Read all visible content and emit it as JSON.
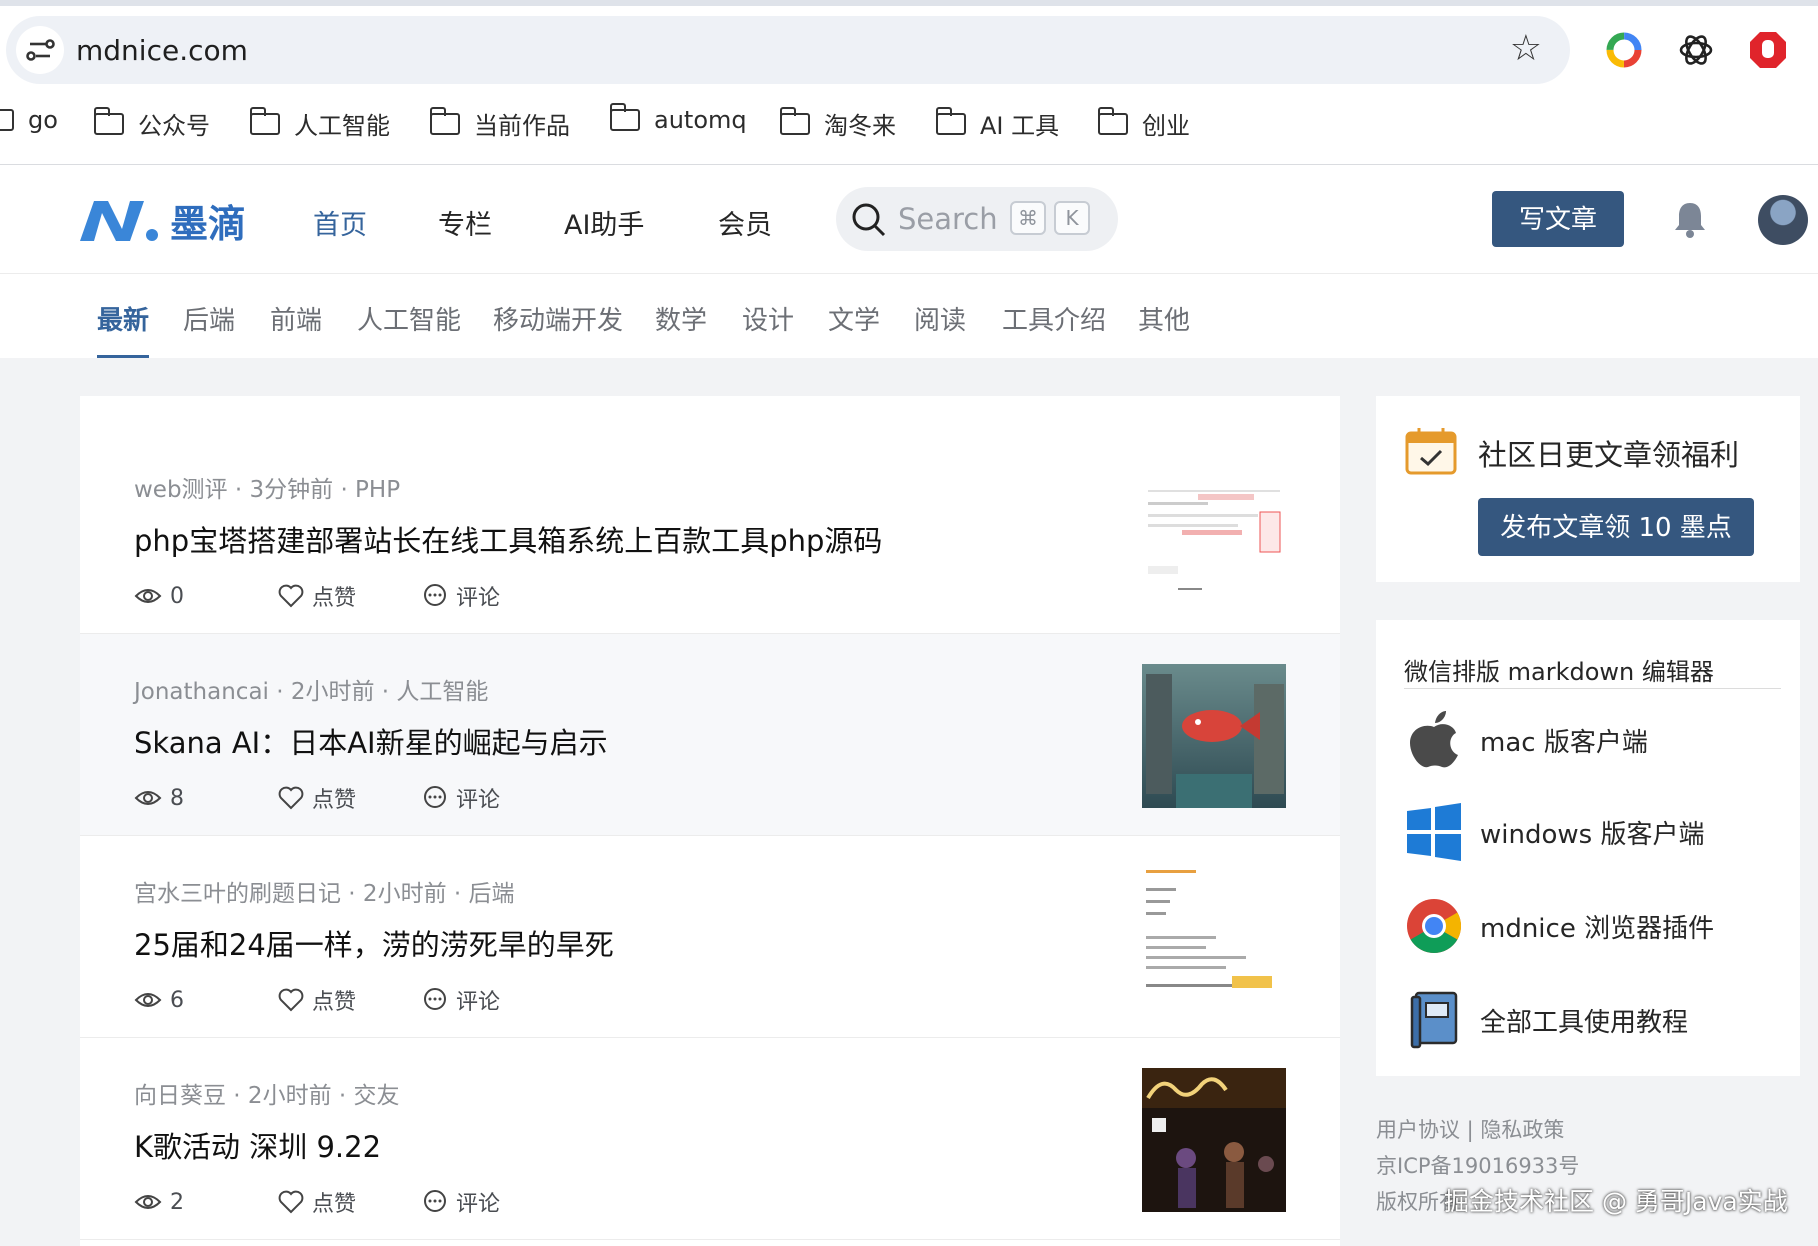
{
  "browser": {
    "url": "mdnice.com",
    "bookmarks": [
      "go",
      "公众号",
      "人工智能",
      "当前作品",
      "automq",
      "淘冬来",
      "AI 工具",
      "创业"
    ]
  },
  "nav": {
    "logo_text": "墨滴",
    "links": [
      "首页",
      "专栏",
      "AI助手",
      "会员"
    ],
    "search_placeholder": "Search",
    "kbd_cmd": "⌘",
    "kbd_k": "K",
    "write_label": "写文章"
  },
  "categories": [
    "最新",
    "后端",
    "前端",
    "人工智能",
    "移动端开发",
    "数学",
    "设计",
    "文学",
    "阅读",
    "工具介绍",
    "其他"
  ],
  "articles": [
    {
      "meta": "web测评 · 3分钟前 · PHP",
      "title": "php宝塔搭建部署站长在线工具箱系统上百款工具php源码",
      "views": "0",
      "like": "点赞",
      "comment": "评论"
    },
    {
      "meta": "Jonathancai · 2小时前 · 人工智能",
      "title": "Skana AI：日本AI新星的崛起与启示",
      "views": "8",
      "like": "点赞",
      "comment": "评论"
    },
    {
      "meta": "宫水三叶的刷题日记 · 2小时前 · 后端",
      "title": "25届和24届一样，涝的涝死旱的旱死",
      "views": "6",
      "like": "点赞",
      "comment": "评论"
    },
    {
      "meta": "向日葵豆 · 2小时前 · 交友",
      "title": "K歌活动 深圳 9.22",
      "views": "2",
      "like": "点赞",
      "comment": "评论"
    }
  ],
  "sidebar": {
    "promo_title": "社区日更文章领福利",
    "promo_button": "发布文章领 10 墨点",
    "tools_title": "微信排版 markdown 编辑器",
    "tools": [
      "mac 版客户端",
      "windows 版客户端",
      "mdnice 浏览器插件",
      "全部工具使用教程"
    ]
  },
  "footer": {
    "line1": "用户协议 | 隐私政策",
    "line2": "京ICP备19016933号",
    "line3": "版权所有"
  },
  "watermark": "掘金技术社区 @ 勇哥Java实战",
  "colors": {
    "primary": "#35577f",
    "accent": "#35649c",
    "logo": "#2f6dbd"
  }
}
